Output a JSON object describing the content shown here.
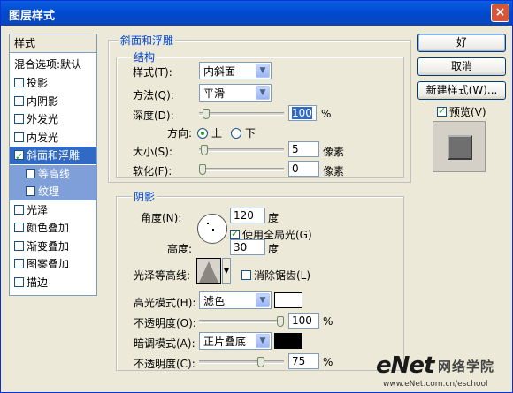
{
  "window": {
    "title": "图层样式",
    "close_glyph": "×"
  },
  "left_panel": {
    "header": "样式",
    "blend_options": "混合选项:默认",
    "items": [
      {
        "label": "投影",
        "checked": false
      },
      {
        "label": "内阴影",
        "checked": false
      },
      {
        "label": "外发光",
        "checked": false
      },
      {
        "label": "内发光",
        "checked": false
      },
      {
        "label": "斜面和浮雕",
        "checked": true
      },
      {
        "label": "等高线",
        "checked": false
      },
      {
        "label": "纹理",
        "checked": false
      },
      {
        "label": "光泽",
        "checked": false
      },
      {
        "label": "颜色叠加",
        "checked": false
      },
      {
        "label": "渐变叠加",
        "checked": false
      },
      {
        "label": "图案叠加",
        "checked": false
      },
      {
        "label": "描边",
        "checked": false
      }
    ]
  },
  "bevel": {
    "title": "斜面和浮雕",
    "structure": {
      "title": "结构",
      "style_label": "样式(T):",
      "style_value": "内斜面",
      "technique_label": "方法(Q):",
      "technique_value": "平滑",
      "depth_label": "深度(D):",
      "depth_value": "100",
      "depth_unit": "%",
      "depth_level": 0.05,
      "direction_label": "方向:",
      "dir_up": "上",
      "dir_down": "下",
      "size_label": "大小(S):",
      "size_value": "5",
      "size_unit": "像素",
      "size_level": 0.02,
      "soften_label": "软化(F):",
      "soften_value": "0",
      "soften_unit": "像素",
      "soften_level": 0.0
    },
    "shading": {
      "title": "阴影",
      "angle_label": "角度(N):",
      "angle_value": "120",
      "angle_unit": "度",
      "global_light_label": "使用全局光(G)",
      "global_light_checked": true,
      "altitude_label": "高度:",
      "altitude_value": "30",
      "altitude_unit": "度",
      "gloss_label": "光泽等高线:",
      "antialias_label": "消除锯齿(L)",
      "highlight_mode_label": "高光模式(H):",
      "highlight_mode_value": "滤色",
      "highlight_color": "#ffffff",
      "highlight_opacity_label": "不透明度(O):",
      "highlight_opacity_value": "100",
      "highlight_opacity_unit": "%",
      "highlight_opacity_level": 1.0,
      "shadow_mode_label": "暗调模式(A):",
      "shadow_mode_value": "正片叠底",
      "shadow_color": "#000000",
      "shadow_opacity_label": "不透明度(C):",
      "shadow_opacity_value": "75",
      "shadow_opacity_unit": "%",
      "shadow_opacity_level": 0.75
    }
  },
  "buttons": {
    "ok": "好",
    "cancel": "取消",
    "new_style": "新建样式(W)...",
    "preview": "预览(V)"
  },
  "watermark": {
    "logo": "eNet",
    "site_cn": "网络学院",
    "url": "www.eNet.com.cn/eschool"
  }
}
